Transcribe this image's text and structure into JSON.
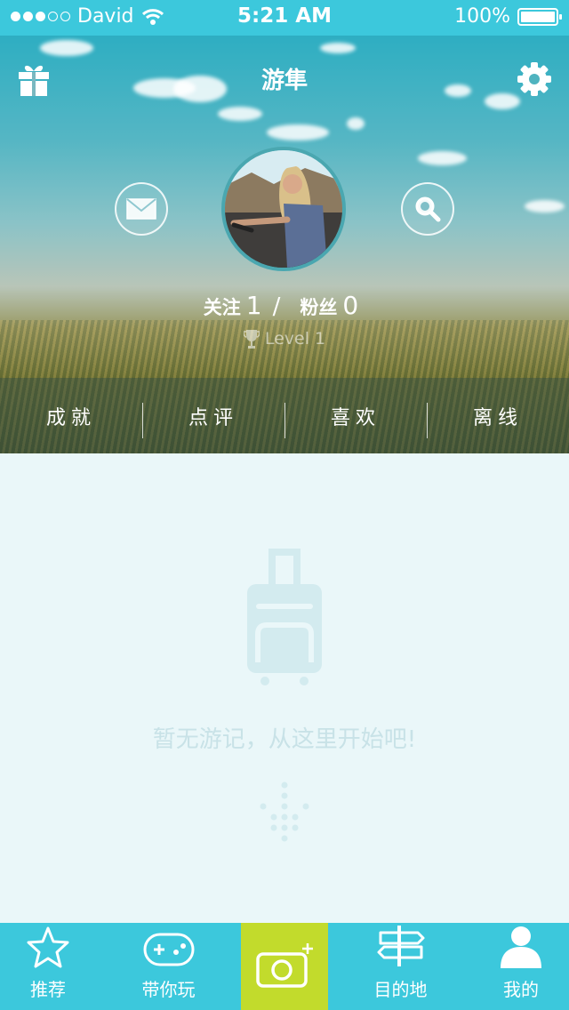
{
  "status_bar": {
    "carrier": "David",
    "time": "5:21 AM",
    "battery": "100%"
  },
  "header": {
    "title": "游隼"
  },
  "profile": {
    "following_label": "关注",
    "following_count": "1",
    "separator": "/",
    "fans_label": "粉丝",
    "fans_count": "0",
    "level": "Level 1"
  },
  "tabs": [
    "成就",
    "点评",
    "喜欢",
    "离线"
  ],
  "empty_state": {
    "message": "暂无游记，从这里开始吧!"
  },
  "tabbar": {
    "items": [
      {
        "label": "推荐",
        "icon": "star-icon"
      },
      {
        "label": "带你玩",
        "icon": "gamepad-icon"
      },
      {
        "label": "",
        "icon": "camera-plus-icon"
      },
      {
        "label": "目的地",
        "icon": "signpost-icon"
      },
      {
        "label": "我的",
        "icon": "user-icon"
      }
    ]
  },
  "colors": {
    "accent": "#3cc8dc",
    "camera": "#c2db2c",
    "background": "#eaf7f9"
  }
}
